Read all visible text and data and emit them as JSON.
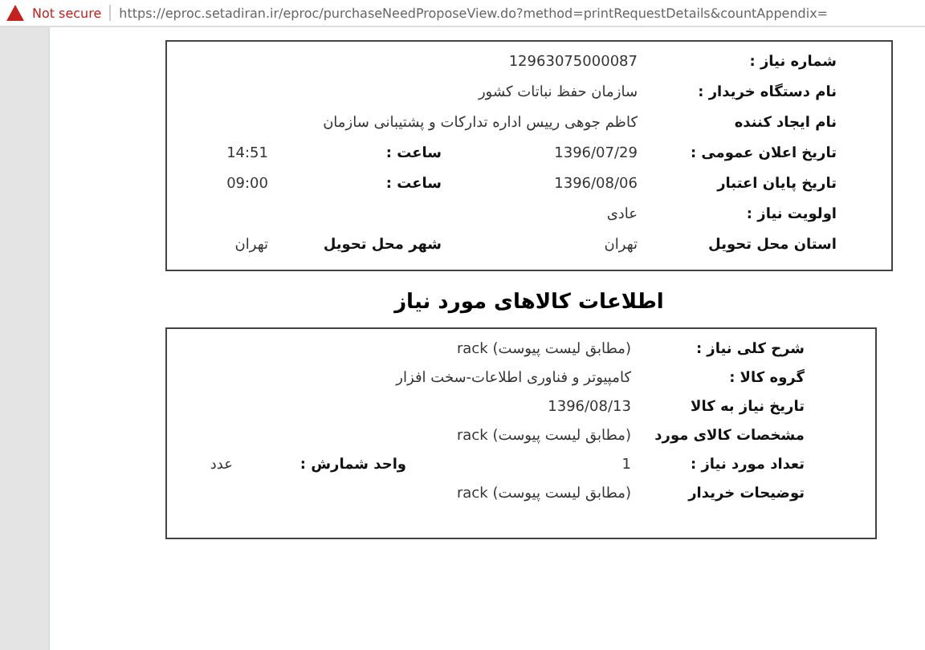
{
  "browser_bar": {
    "security": "Not secure",
    "url": "https://eproc.setadiran.ir/eproc/purchaseNeedProposeView.do?method=printRequestDetails&countAppendix="
  },
  "request": {
    "rows": [
      {
        "label": "شماره نیاز :",
        "value": "12963075000087"
      },
      {
        "label": "نام دستگاه خریدار :",
        "value": "سازمان حفظ نباتات کشور"
      },
      {
        "label": "نام ایجاد کننده",
        "value": "کاظم جوهی رییس اداره تدارکات و پشتیبانی سازمان"
      },
      {
        "label": "تاریخ اعلان عمومی :",
        "value": "1396/07/29",
        "label_2": "ساعت :",
        "value_2": "14:51"
      },
      {
        "label": "تاریخ پایان اعتبار",
        "value": "1396/08/06",
        "label_2": "ساعت :",
        "value_2": "09:00"
      },
      {
        "label": "اولویت نیاز :",
        "value": "عادی"
      },
      {
        "label": "استان محل تحویل",
        "value": "تهران",
        "label_2": "شهر محل تحویل",
        "value_2": "تهران"
      }
    ]
  },
  "goods_title": "اطلاعات کالاهای مورد نیاز",
  "goods": {
    "rows": [
      {
        "label": "شرح کلی نیاز :",
        "value": "(مطابق لیست پیوست) rack"
      },
      {
        "label": "گروه کالا :",
        "value": "کامپیوتر و فناوری اطلاعات-سخت افزار"
      },
      {
        "label": "تاریخ نیاز به کالا",
        "value": "1396/08/13"
      },
      {
        "label": "مشخصات کالای مورد",
        "value": "(مطابق لیست پیوست) rack"
      },
      {
        "label": "تعداد مورد نیاز :",
        "value": "1",
        "label_2": "واحد شمارش :",
        "value_2": "عدد"
      },
      {
        "label": "توضیحات خریدار",
        "value": "(مطابق لیست پیوست) rack"
      }
    ]
  }
}
